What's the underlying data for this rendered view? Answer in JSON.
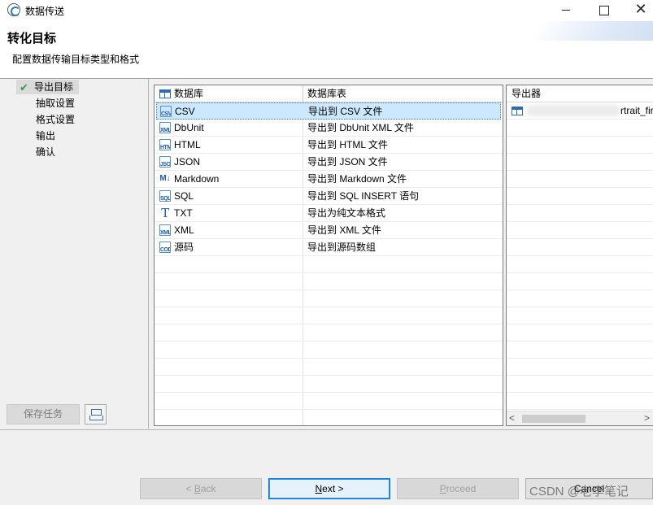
{
  "window": {
    "title": "数据传送",
    "close_glyph": "✕"
  },
  "header": {
    "title": "转化目标",
    "description": "配置数据传输目标类型和格式"
  },
  "steps": {
    "items": [
      {
        "label": "导出目标",
        "active": true
      },
      {
        "label": "抽取设置",
        "active": false
      },
      {
        "label": "格式设置",
        "active": false
      },
      {
        "label": "输出",
        "active": false
      },
      {
        "label": "确认",
        "active": false
      }
    ],
    "save_task_label": "保存任务"
  },
  "table": {
    "col_database": "数据库",
    "col_database_table": "数据库表",
    "rows": [
      {
        "name": "CSV",
        "desc": "导出到 CSV 文件",
        "icon": "csv-icon",
        "icon_text": "CSV",
        "selected": true
      },
      {
        "name": "DbUnit",
        "desc": "导出到 DbUnit XML 文件",
        "icon": "dbunit-icon",
        "icon_text": "XML",
        "selected": false
      },
      {
        "name": "HTML",
        "desc": "导出到 HTML 文件",
        "icon": "html-icon",
        "icon_text": "HTML",
        "selected": false
      },
      {
        "name": "JSON",
        "desc": "导出到 JSON 文件",
        "icon": "json-icon",
        "icon_text": "JSON",
        "selected": false
      },
      {
        "name": "Markdown",
        "desc": "导出到 Markdown 文件",
        "icon": "markdown-icon",
        "icon_text": "M↓",
        "selected": false
      },
      {
        "name": "SQL",
        "desc": "导出到 SQL INSERT 语句",
        "icon": "sql-icon",
        "icon_text": "SQL",
        "selected": false
      },
      {
        "name": "TXT",
        "desc": "导出为纯文本格式",
        "icon": "txt-icon",
        "icon_text": "T",
        "selected": false
      },
      {
        "name": "XML",
        "desc": "导出到 XML 文件",
        "icon": "xml-icon",
        "icon_text": "XML",
        "selected": false
      },
      {
        "name": "源码",
        "desc": "导出到源码数组",
        "icon": "code-icon",
        "icon_text": "CODE",
        "selected": false
      }
    ],
    "empty_rows": 10
  },
  "exporter": {
    "header": "导出器",
    "item_text": "rtrait_fir"
  },
  "buttons": {
    "back": {
      "prefix": "< ",
      "mnemonic": "B",
      "rest": "ack"
    },
    "next": {
      "mnemonic": "N",
      "rest": "ext >"
    },
    "proceed": {
      "mnemonic": "P",
      "rest": "roceed"
    },
    "cancel": "Cancel"
  },
  "watermark": "CSDN @老李笔记",
  "colors": {
    "selection": "#cce8ff",
    "accent_blue": "#0078d7",
    "check_green": "#2e9e3c",
    "icon_blue": "#1e5ea8"
  }
}
